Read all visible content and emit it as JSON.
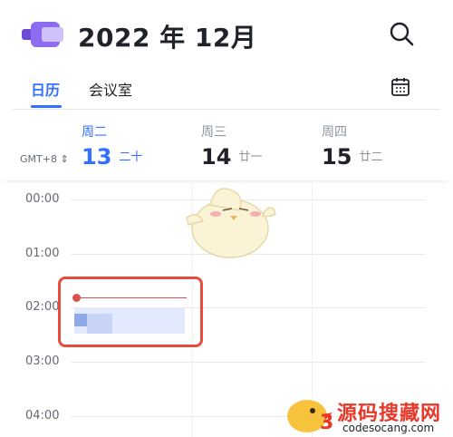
{
  "header": {
    "title": "2022 年 12月",
    "logo_icon": "app-logo-icon",
    "search_icon": "search-icon"
  },
  "tabs": {
    "items": [
      {
        "label": "日历",
        "active": true
      },
      {
        "label": "会议室",
        "active": false
      }
    ],
    "calendar_icon": "calendar-icon"
  },
  "daybar": {
    "timezone": "GMT+8 ⇕",
    "days": [
      {
        "weekday": "周二",
        "date": "13",
        "lunar": "二十",
        "today": true
      },
      {
        "weekday": "周三",
        "date": "14",
        "lunar": "廿一",
        "today": false
      },
      {
        "weekday": "周四",
        "date": "15",
        "lunar": "廿二",
        "today": false
      }
    ]
  },
  "timeline": {
    "hours": [
      "00:00",
      "01:00",
      "02:00",
      "03:00",
      "04:00"
    ]
  },
  "event": {
    "title": ""
  },
  "watermark": {
    "text": "源码搜藏网",
    "url": "codesocang.com",
    "prefix": "3"
  },
  "colors": {
    "accent": "#3370ff",
    "now_line": "#d9534f",
    "highlight": "#e84a3c",
    "event_bg": "#e3e9ff"
  }
}
